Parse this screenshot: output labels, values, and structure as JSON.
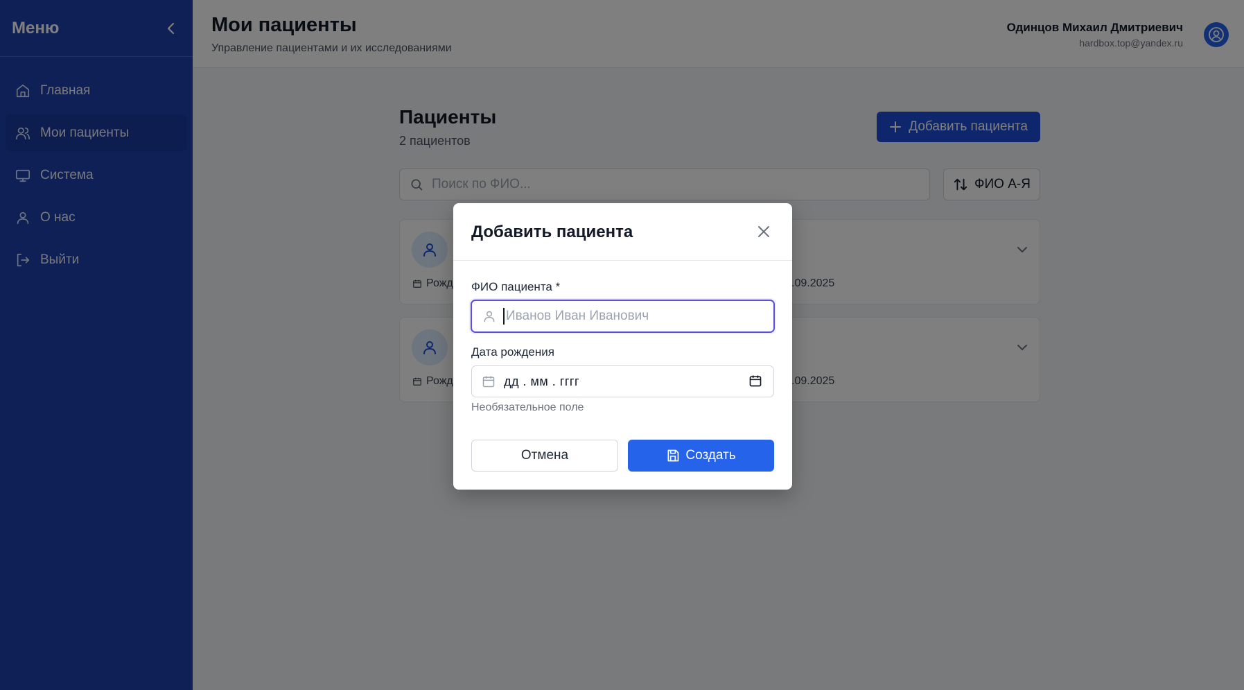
{
  "sidebar": {
    "title": "Меню",
    "items": [
      {
        "label": "Главная",
        "icon": "home-icon"
      },
      {
        "label": "Мои пациенты",
        "icon": "users-icon",
        "active": true
      },
      {
        "label": "Система",
        "icon": "monitor-icon"
      },
      {
        "label": "О нас",
        "icon": "user-icon"
      },
      {
        "label": "Выйти",
        "icon": "logout-icon"
      }
    ]
  },
  "header": {
    "title": "Мои пациенты",
    "subtitle": "Управление пациентами и их исследованиями",
    "user_name": "Одинцов Михаил Дмитриевич",
    "user_email": "hardbox.top@yandex.ru"
  },
  "patients": {
    "title": "Пациенты",
    "count": "2 пациентов",
    "add_label": "Добавить пациента",
    "search_placeholder": "Поиск по ФИО...",
    "sort_label": "ФИО А-Я",
    "cards": [
      {
        "birth_prefix": "Рожд",
        "date_partial": ".09.2025"
      },
      {
        "birth_prefix": "Рожд",
        "date_partial": ".09.2025"
      }
    ]
  },
  "modal": {
    "title": "Добавить пациента",
    "name_label": "ФИО пациента *",
    "name_placeholder": "Иванов Иван Иванович",
    "birth_label": "Дата рождения",
    "date_placeholder": "дд . мм . гггг",
    "hint": "Необязательное поле",
    "cancel_label": "Отмена",
    "create_label": "Создать"
  },
  "colors": {
    "sidebar_bg": "#1e40af",
    "primary": "#2563eb",
    "focus_border": "#5b4fd6"
  }
}
